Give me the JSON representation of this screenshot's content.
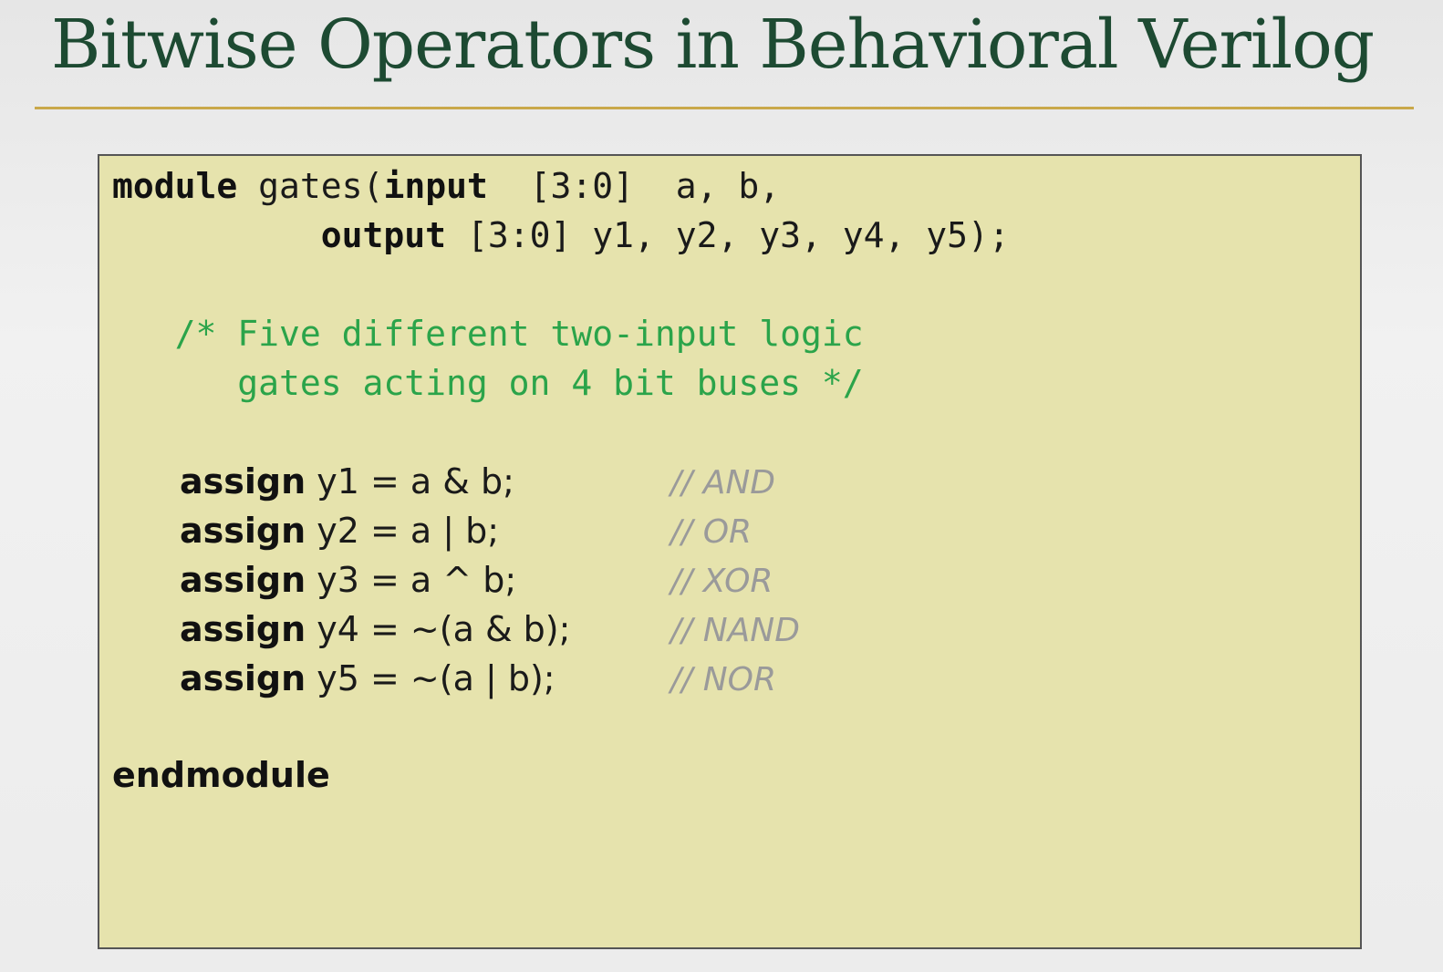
{
  "slide": {
    "title": "Bitwise Operators in Behavioral Verilog"
  },
  "code": {
    "module_line": {
      "keyword": "module",
      "name_open": " gates(",
      "input_keyword": "input",
      "input_rest": "  [3:0]  a, b,"
    },
    "output_line": {
      "indent": "          ",
      "output_keyword": "output",
      "output_rest": " [3:0] y1, y2, y3, y4, y5);"
    },
    "block_comment": {
      "line1": "   /* Five different two-input logic",
      "line2": "      gates acting on 4 bit buses */"
    },
    "assigns": [
      {
        "keyword": "assign",
        "statement": " y1 = a & b;",
        "comment": "// AND"
      },
      {
        "keyword": "assign",
        "statement": " y2 = a | b;",
        "comment": "// OR"
      },
      {
        "keyword": "assign",
        "statement": " y3 = a ^ b;",
        "comment": "// XOR"
      },
      {
        "keyword": "assign",
        "statement": " y4 = ~(a & b);",
        "comment": "// NAND"
      },
      {
        "keyword": "assign",
        "statement": " y5 = ~(a | b);",
        "comment": "// NOR"
      }
    ],
    "end_keyword": "endmodule"
  }
}
